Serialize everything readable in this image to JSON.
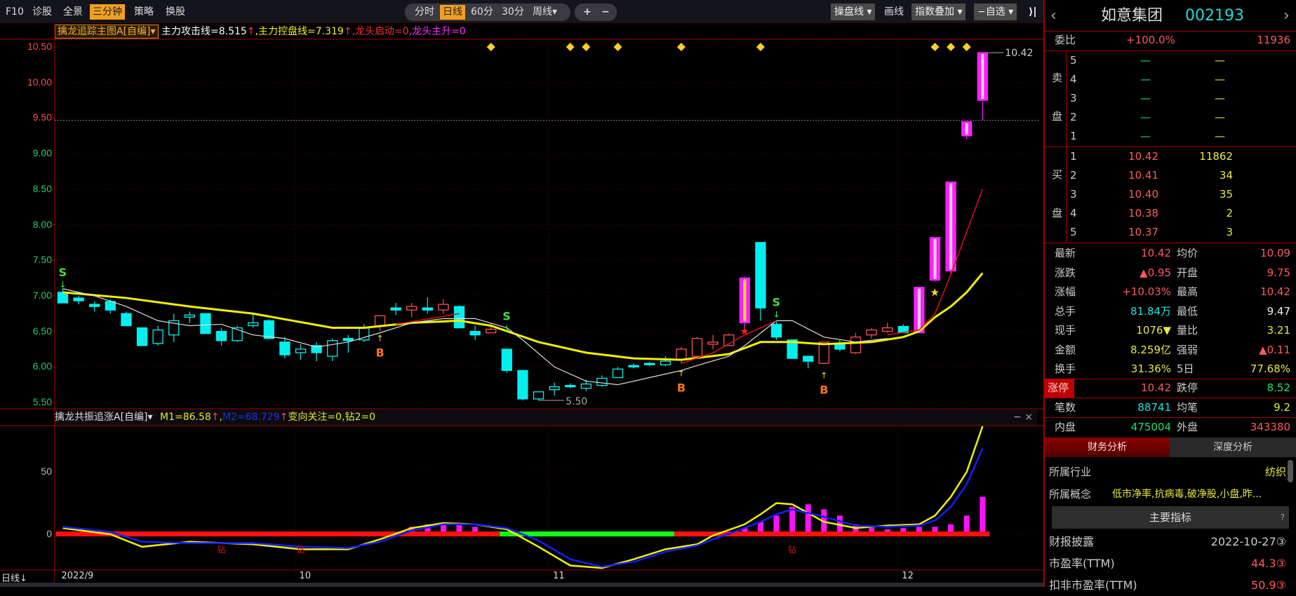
{
  "toolbar": {
    "left": [
      "F10",
      "诊股",
      "全景",
      "三分钟",
      "策略",
      "换股"
    ],
    "active_left": "三分钟",
    "periods": [
      "分时",
      "日线",
      "60分",
      "30分",
      "周线▾"
    ],
    "active_period": "日线",
    "zoom_in": "+",
    "zoom_out": "−",
    "right": {
      "caopan": "操盘线 ▾",
      "huaxian": "画线",
      "zhishu": "指数叠加 ▾",
      "zixuan": "−自选 ▾",
      "collapse": "⟩|"
    }
  },
  "main_indicator": {
    "name": "擒龙追踪主图A[自编]▾",
    "attack": "主力攻击线=8.515",
    "attack_arrow": "↑",
    "control": ",主力控盘线=7.319",
    "control_arrow": "↑",
    "start": ",龙头启动=0",
    "rise": ",龙头主升=0"
  },
  "lower_indicator": {
    "name": "擒龙共振追涨A[自编]▾",
    "m1": "M1=86.58",
    "m1_arrow": "↑",
    ",": ",",
    "m2": "M2=68.729",
    "m2_arrow": "↑",
    "rest": "变向关注=0,钻2=0",
    "close": "− ×"
  },
  "price_axis": [
    "10.50",
    "10.00",
    "9.50",
    "9.00",
    "8.50",
    "8.00",
    "7.50",
    "7.00",
    "6.50",
    "6.00",
    "5.50"
  ],
  "lower_axis": [
    "50",
    "0"
  ],
  "date_axis": {
    "period_label": "日线↓",
    "labels": [
      {
        "i": 0,
        "t": "2022/9"
      },
      {
        "i": 15,
        "t": "10"
      },
      {
        "i": 31,
        "t": "11"
      },
      {
        "i": 53,
        "t": "12"
      }
    ]
  },
  "chart_data": {
    "type": "candlestick",
    "ylim": [
      5.5,
      10.5
    ],
    "prev_close": 9.47,
    "high_label": "10.42",
    "low_label": "5.50",
    "candles": [
      [
        7.05,
        7.1,
        6.9,
        6.9,
        "cf"
      ],
      [
        6.97,
        7.0,
        6.88,
        6.93,
        "cf"
      ],
      [
        6.88,
        6.92,
        6.78,
        6.85,
        "cf"
      ],
      [
        6.92,
        6.95,
        6.75,
        6.8,
        "cf"
      ],
      [
        6.75,
        6.78,
        6.58,
        6.58,
        "cf"
      ],
      [
        6.55,
        6.55,
        6.3,
        6.3,
        "cf"
      ],
      [
        6.33,
        6.58,
        6.3,
        6.52,
        "ch"
      ],
      [
        6.45,
        6.75,
        6.35,
        6.65,
        "ch"
      ],
      [
        6.7,
        6.78,
        6.62,
        6.73,
        "ch"
      ],
      [
        6.75,
        6.75,
        6.47,
        6.47,
        "cf"
      ],
      [
        6.5,
        6.55,
        6.3,
        6.37,
        "cf"
      ],
      [
        6.37,
        6.58,
        6.35,
        6.55,
        "ch"
      ],
      [
        6.58,
        6.75,
        6.55,
        6.62,
        "ch"
      ],
      [
        6.65,
        6.67,
        6.4,
        6.4,
        "cf"
      ],
      [
        6.35,
        6.42,
        6.12,
        6.17,
        "cf"
      ],
      [
        6.2,
        6.32,
        6.1,
        6.25,
        "ch"
      ],
      [
        6.3,
        6.35,
        6.08,
        6.2,
        "cf"
      ],
      [
        6.15,
        6.4,
        6.08,
        6.37,
        "ch"
      ],
      [
        6.4,
        6.45,
        6.2,
        6.37,
        "cf"
      ],
      [
        6.38,
        6.6,
        6.35,
        6.55,
        "ch"
      ],
      [
        6.58,
        6.72,
        6.5,
        6.72,
        "rh"
      ],
      [
        6.83,
        6.9,
        6.73,
        6.8,
        "cf"
      ],
      [
        6.8,
        6.9,
        6.7,
        6.85,
        "rh"
      ],
      [
        6.83,
        6.98,
        6.75,
        6.8,
        "cf"
      ],
      [
        6.8,
        6.95,
        6.75,
        6.88,
        "rh"
      ],
      [
        6.85,
        6.87,
        6.55,
        6.55,
        "cf"
      ],
      [
        6.5,
        6.58,
        6.38,
        6.45,
        "cf"
      ],
      [
        6.48,
        6.62,
        6.48,
        6.53,
        "rh"
      ],
      [
        6.25,
        6.25,
        5.92,
        5.95,
        "cf"
      ],
      [
        5.95,
        5.95,
        5.53,
        5.55,
        "cf"
      ],
      [
        5.55,
        5.65,
        5.53,
        5.65,
        "ch"
      ],
      [
        5.68,
        5.78,
        5.6,
        5.72,
        "ch"
      ],
      [
        5.74,
        5.77,
        5.7,
        5.72,
        "cf"
      ],
      [
        5.7,
        5.82,
        5.66,
        5.76,
        "ch"
      ],
      [
        5.74,
        5.88,
        5.72,
        5.84,
        "ch"
      ],
      [
        5.85,
        6.0,
        5.85,
        5.97,
        "ch"
      ],
      [
        6.02,
        6.05,
        5.98,
        6.0,
        "cf"
      ],
      [
        6.05,
        6.07,
        6.01,
        6.03,
        "cf"
      ],
      [
        6.03,
        6.15,
        6.01,
        6.08,
        "ch"
      ],
      [
        6.1,
        6.28,
        6.05,
        6.25,
        "rh"
      ],
      [
        6.15,
        6.42,
        6.15,
        6.4,
        "rh"
      ],
      [
        6.32,
        6.45,
        6.25,
        6.35,
        "rh"
      ],
      [
        6.3,
        6.47,
        6.3,
        6.45,
        "rh"
      ],
      [
        6.62,
        7.27,
        6.55,
        7.25,
        "my"
      ],
      [
        7.75,
        7.75,
        6.65,
        6.83,
        "cf"
      ],
      [
        6.6,
        6.65,
        6.38,
        6.42,
        "cf"
      ],
      [
        6.38,
        6.38,
        6.12,
        6.12,
        "cf"
      ],
      [
        6.15,
        6.15,
        5.98,
        6.08,
        "cf"
      ],
      [
        6.05,
        6.35,
        6.05,
        6.35,
        "rh"
      ],
      [
        6.32,
        6.38,
        6.22,
        6.25,
        "cf"
      ],
      [
        6.2,
        6.48,
        6.18,
        6.42,
        "rh"
      ],
      [
        6.45,
        6.55,
        6.4,
        6.52,
        "rh"
      ],
      [
        6.5,
        6.62,
        6.48,
        6.55,
        "rh"
      ],
      [
        6.57,
        6.6,
        6.48,
        6.48,
        "cf"
      ],
      [
        6.48,
        7.12,
        6.48,
        7.12,
        "m"
      ],
      [
        7.22,
        7.82,
        7.2,
        7.82,
        "m"
      ],
      [
        7.35,
        8.6,
        7.3,
        8.6,
        "m"
      ],
      [
        9.25,
        9.46,
        9.2,
        9.45,
        "m"
      ],
      [
        9.75,
        10.42,
        9.47,
        10.42,
        "m"
      ]
    ],
    "yellow_line": [
      [
        0,
        7.05
      ],
      [
        4,
        6.97
      ],
      [
        8,
        6.85
      ],
      [
        12,
        6.75
      ],
      [
        17,
        6.55
      ],
      [
        19,
        6.55
      ],
      [
        22,
        6.62
      ],
      [
        25,
        6.65
      ],
      [
        27,
        6.58
      ],
      [
        30,
        6.35
      ],
      [
        33,
        6.2
      ],
      [
        36,
        6.12
      ],
      [
        39,
        6.1
      ],
      [
        42,
        6.18
      ],
      [
        44,
        6.35
      ],
      [
        46,
        6.35
      ],
      [
        48,
        6.32
      ],
      [
        51,
        6.35
      ],
      [
        53,
        6.42
      ],
      [
        54,
        6.5
      ],
      [
        55,
        6.7
      ],
      [
        56,
        6.85
      ],
      [
        57,
        7.05
      ],
      [
        58,
        7.32
      ]
    ],
    "white_line": [
      [
        0,
        7.1
      ],
      [
        2,
        7.0
      ],
      [
        4,
        6.85
      ],
      [
        6,
        6.65
      ],
      [
        8,
        6.58
      ],
      [
        10,
        6.6
      ],
      [
        12,
        6.45
      ],
      [
        14,
        6.4
      ],
      [
        16,
        6.28
      ],
      [
        18,
        6.35
      ],
      [
        20,
        6.48
      ],
      [
        22,
        6.62
      ],
      [
        24,
        6.68
      ],
      [
        26,
        6.68
      ],
      [
        28,
        6.55
      ],
      [
        29,
        6.38
      ],
      [
        31,
        6.0
      ],
      [
        33,
        5.8
      ],
      [
        35,
        5.75
      ],
      [
        37,
        5.85
      ],
      [
        39,
        5.95
      ],
      [
        40,
        6.02
      ],
      [
        42,
        6.15
      ],
      [
        43,
        6.3
      ],
      [
        45,
        6.65
      ],
      [
        46,
        6.65
      ],
      [
        48,
        6.42
      ],
      [
        50,
        6.35
      ],
      [
        52,
        6.4
      ]
    ],
    "red_line": [
      [
        [
          21,
          6.6
        ],
        [
          25,
          6.75
        ]
      ],
      [
        [
          39,
          6.05
        ],
        [
          41,
          6.2
        ],
        [
          43,
          6.45
        ],
        [
          44,
          6.55
        ],
        [
          45,
          6.65
        ]
      ],
      [
        [
          52,
          6.45
        ],
        [
          54,
          6.52
        ],
        [
          55,
          6.75
        ],
        [
          56,
          7.3
        ],
        [
          57,
          7.9
        ],
        [
          58,
          8.5
        ]
      ]
    ],
    "diamonds": [
      27,
      32,
      33,
      35,
      39,
      44,
      55,
      56,
      57
    ],
    "signals": [
      {
        "i": 0,
        "t": "S",
        "p": 7.1
      },
      {
        "i": 28,
        "t": "S",
        "p": 6.48
      },
      {
        "i": 45,
        "t": "S",
        "p": 6.68
      },
      {
        "i": 20,
        "t": "B",
        "p": 6.5
      },
      {
        "i": 39,
        "t": "B",
        "p": 6.01
      },
      {
        "i": 48,
        "t": "B",
        "p": 5.98
      }
    ],
    "stars": [
      {
        "i": 43,
        "p": 6.5,
        "c": "#ff2020"
      },
      {
        "i": 55,
        "p": 7.05,
        "c": "#ffe020"
      }
    ],
    "lower": {
      "ylim": [
        -28,
        90
      ],
      "bars": [
        [
          22,
          6
        ],
        [
          23,
          8
        ],
        [
          24,
          8
        ],
        [
          25,
          8
        ],
        [
          26,
          6
        ],
        [
          43,
          5
        ],
        [
          44,
          10
        ],
        [
          45,
          15
        ],
        [
          46,
          22
        ],
        [
          47,
          24
        ],
        [
          48,
          20
        ],
        [
          49,
          15
        ],
        [
          50,
          8
        ],
        [
          51,
          5
        ],
        [
          52,
          4
        ],
        [
          53,
          5
        ],
        [
          54,
          6
        ],
        [
          55,
          6
        ],
        [
          56,
          8
        ],
        [
          57,
          15
        ],
        [
          58,
          30
        ]
      ],
      "m1": [
        [
          0,
          5
        ],
        [
          3,
          0
        ],
        [
          5,
          -10
        ],
        [
          8,
          -6
        ],
        [
          12,
          -8
        ],
        [
          15,
          -12
        ],
        [
          18,
          -12
        ],
        [
          20,
          -4
        ],
        [
          22,
          5
        ],
        [
          24,
          9
        ],
        [
          26,
          8
        ],
        [
          28,
          4
        ],
        [
          30,
          -10
        ],
        [
          32,
          -25
        ],
        [
          34,
          -27
        ],
        [
          36,
          -20
        ],
        [
          38,
          -12
        ],
        [
          40,
          -8
        ],
        [
          41,
          -1
        ],
        [
          43,
          8
        ],
        [
          44,
          16
        ],
        [
          45,
          25
        ],
        [
          46,
          24
        ],
        [
          48,
          10
        ],
        [
          50,
          5
        ],
        [
          52,
          7
        ],
        [
          54,
          8
        ],
        [
          55,
          15
        ],
        [
          56,
          30
        ],
        [
          57,
          50
        ],
        [
          58,
          86.58
        ]
      ],
      "m2": [
        [
          0,
          6
        ],
        [
          3,
          2
        ],
        [
          5,
          -6
        ],
        [
          8,
          -7
        ],
        [
          12,
          -7
        ],
        [
          15,
          -10
        ],
        [
          18,
          -11
        ],
        [
          20,
          -6
        ],
        [
          22,
          3
        ],
        [
          24,
          8
        ],
        [
          26,
          8
        ],
        [
          28,
          5
        ],
        [
          30,
          -5
        ],
        [
          32,
          -20
        ],
        [
          34,
          -26
        ],
        [
          36,
          -22
        ],
        [
          38,
          -14
        ],
        [
          40,
          -9
        ],
        [
          41,
          -4
        ],
        [
          43,
          5
        ],
        [
          44,
          10
        ],
        [
          45,
          16
        ],
        [
          46,
          20
        ],
        [
          48,
          14
        ],
        [
          50,
          7
        ],
        [
          52,
          6
        ],
        [
          54,
          7
        ],
        [
          55,
          11
        ],
        [
          56,
          22
        ],
        [
          57,
          40
        ],
        [
          58,
          68.73
        ]
      ],
      "baseline": [
        {
          "from": 0,
          "to": 28,
          "c": "#ff1010"
        },
        {
          "from": 28,
          "to": 39,
          "c": "#10ff10"
        },
        {
          "from": 39,
          "to": 58,
          "c": "#ff1010"
        }
      ],
      "zuan": [
        {
          "i": 10,
          "t": "钻"
        },
        {
          "i": 15,
          "t": "钻"
        },
        {
          "i": 46,
          "t": "钻"
        }
      ]
    }
  },
  "quote": {
    "name": "如意集团",
    "code": "002193",
    "weibi": {
      "label": "委比",
      "pct": "+100.0%",
      "val": "11936"
    },
    "sell_label": [
      "卖",
      "盘"
    ],
    "buy_label": [
      "买",
      "盘"
    ],
    "sell": [
      {
        "n": "5",
        "p": "—",
        "v": "—"
      },
      {
        "n": "4",
        "p": "—",
        "v": "—"
      },
      {
        "n": "3",
        "p": "—",
        "v": "—"
      },
      {
        "n": "2",
        "p": "—",
        "v": "—"
      },
      {
        "n": "1",
        "p": "—",
        "v": "—"
      }
    ],
    "buy": [
      {
        "n": "1",
        "p": "10.42",
        "v": "11862"
      },
      {
        "n": "2",
        "p": "10.41",
        "v": "34"
      },
      {
        "n": "3",
        "p": "10.40",
        "v": "35"
      },
      {
        "n": "4",
        "p": "10.38",
        "v": "2"
      },
      {
        "n": "5",
        "p": "10.37",
        "v": "3"
      }
    ],
    "stats": [
      {
        "l1": "最新",
        "v1": "10.42",
        "c1": "red",
        "l2": "均价",
        "v2": "10.09",
        "c2": "red"
      },
      {
        "l1": "涨跌",
        "v1": "▲0.95",
        "c1": "red",
        "l2": "开盘",
        "v2": "9.75",
        "c2": "red"
      },
      {
        "l1": "涨幅",
        "v1": "+10.03%",
        "c1": "red",
        "l2": "最高",
        "v2": "10.42",
        "c2": "red"
      },
      {
        "l1": "总手",
        "v1": "81.84万",
        "c1": "cyn",
        "l2": "最低",
        "v2": "9.47",
        "c2": "wht"
      },
      {
        "l1": "现手",
        "v1": "1076▼",
        "c1": "yel",
        "l2": "量比",
        "v2": "3.21",
        "c2": "yel"
      },
      {
        "l1": "金额",
        "v1": "8.259亿",
        "c1": "yel",
        "l2": "强弱",
        "v2": "▲0.11",
        "c2": "red"
      },
      {
        "l1": "换手",
        "v1": "31.36%",
        "c1": "yel",
        "l2": "5日",
        "v2": "77.68%",
        "c2": "yel"
      }
    ],
    "limit": {
      "l1": "涨停",
      "v1": "10.42",
      "l2": "跌停",
      "v2": "8.52"
    },
    "trades": {
      "l1": "笔数",
      "v1": "88741",
      "l2": "均笔",
      "v2": "9.2"
    },
    "inout": {
      "l1": "内盘",
      "v1": "475004",
      "l2": "外盘",
      "v2": "343380"
    },
    "tabs": [
      "财务分析",
      "深度分析"
    ],
    "industry": {
      "label": "所属行业",
      "value": "纺织"
    },
    "concept": {
      "label": "所属概念",
      "value": "低市净率,抗病毒,破净股,小盘,昨..."
    },
    "main_header": "主要指标",
    "help": "?",
    "fin": [
      {
        "l": "财报披露",
        "v": "2022-10-27③",
        "c": "gry"
      },
      {
        "l": "市盈率(TTM)",
        "v": "44.3③",
        "c": "red"
      },
      {
        "l": "扣非市盈率(TTM)",
        "v": "50.9③",
        "c": "red"
      }
    ]
  }
}
